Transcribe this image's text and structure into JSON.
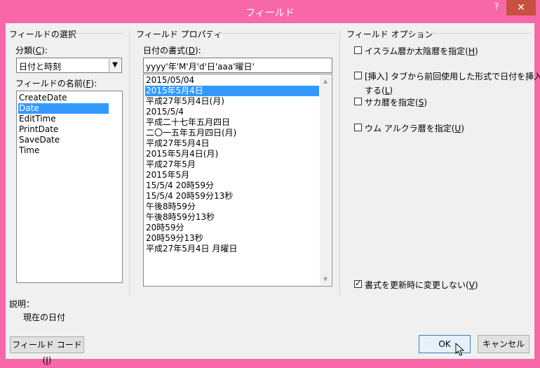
{
  "window": {
    "title": "フィールド",
    "help_label": "?",
    "close_label": "✕"
  },
  "field_select": {
    "group_title": "フィールドの選択",
    "category_label": "分類(",
    "category_key": "C",
    "category_suffix": "):",
    "category_value": "日付と時刻",
    "names_label": "フィールドの名前(",
    "names_key": "F",
    "names_suffix": "):",
    "names": [
      "CreateDate",
      "Date",
      "EditTime",
      "PrintDate",
      "SaveDate",
      "Time"
    ],
    "selected_name": "Date"
  },
  "field_properties": {
    "group_title": "フィールド プロパティ",
    "format_label": "日付の書式(",
    "format_key": "D",
    "format_suffix": "):",
    "format_value": "yyyy'年'M'月'd'日'aaa'曜日'",
    "formats": [
      "2015/05/04",
      "2015年5月4日",
      "平成27年5月4日(月)",
      "2015/5/4",
      "平成二十七年五月四日",
      "二〇一五年五月四日(月)",
      "平成27年5月4日",
      "2015年5月4日(月)",
      "平成27年5月",
      "2015年5月",
      "15/5/4 20時59分",
      "15/5/4 20時59分13秒",
      "午後8時59分",
      "午後8時59分13秒",
      "20時59分",
      "20時59分13秒",
      "平成27年5月4日 月曜日"
    ],
    "selected_format": "2015年5月4日"
  },
  "field_options": {
    "group_title": "フィールド オプション",
    "opt1": {
      "label": "イスラム暦か太陰暦を指定(",
      "key": "H",
      "suffix": ")"
    },
    "opt2_line1": "[挿入] タブから前回使用した形式で日付を挿入",
    "opt2_line2_pre": "する(",
    "opt2_key": "L",
    "opt2_suffix": ")",
    "opt3": {
      "label": "サカ暦を指定(",
      "key": "S",
      "suffix": ")"
    },
    "opt4": {
      "label": "ウム アルクラ暦を指定(",
      "key": "U",
      "suffix": ")"
    },
    "preserve": {
      "label": "書式を更新時に変更しない(",
      "key": "V",
      "suffix": ")",
      "checked": true
    }
  },
  "description": {
    "label": "説明：",
    "text": "現在の日付"
  },
  "buttons": {
    "field_code_pre": "フィールド コード(",
    "field_code_key": "I",
    "field_code_suffix": ")",
    "ok": "OK",
    "cancel": "キャンセル"
  }
}
